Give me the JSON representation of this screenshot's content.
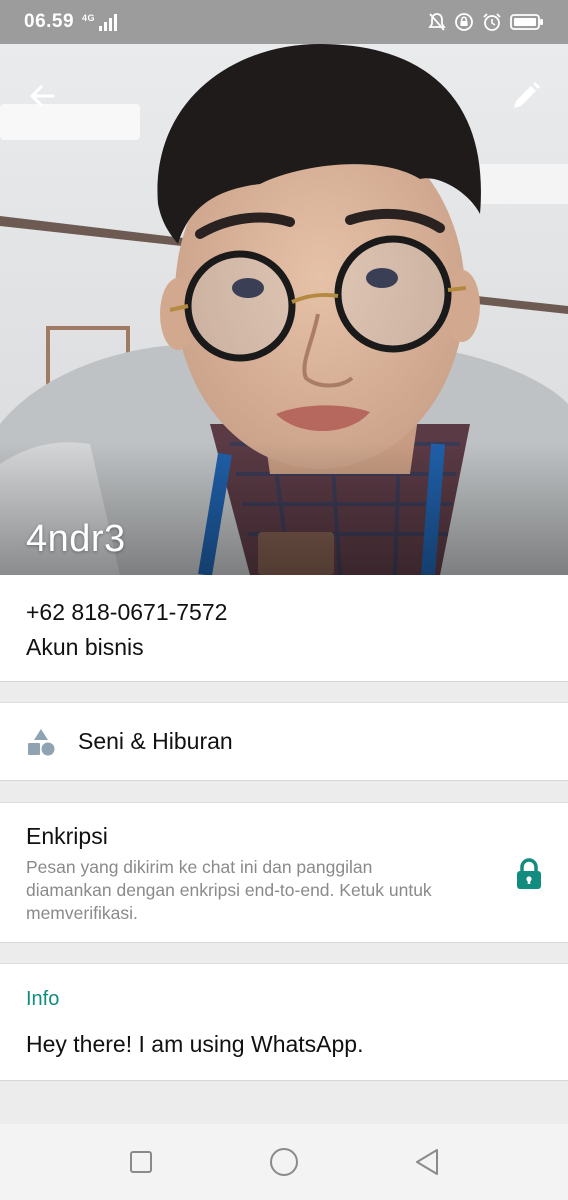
{
  "status_bar": {
    "time": "06.59",
    "network": "4G",
    "icons": [
      "mute-icon",
      "data-saver-icon",
      "alarm-icon",
      "battery-icon"
    ]
  },
  "header": {
    "profile_name": "4ndr3",
    "back_icon": "arrow-back-icon",
    "edit_icon": "pencil-icon"
  },
  "contact": {
    "phone": "+62 818-0671-7572",
    "account_type": "Akun bisnis"
  },
  "category": {
    "label": "Seni & Hiburan",
    "icon": "category-shapes-icon"
  },
  "encryption": {
    "title": "Enkripsi",
    "description": "Pesan yang dikirim ke chat ini dan panggilan diamankan dengan enkripsi end-to-end. Ketuk untuk memverifikasi.",
    "icon": "lock-icon"
  },
  "info": {
    "title": "Info",
    "about": "Hey there! I am using WhatsApp."
  },
  "nav": {
    "buttons": [
      "recents-square-icon",
      "home-circle-icon",
      "back-triangle-icon"
    ]
  },
  "colors": {
    "accent": "#128c7e",
    "status_bar": "#9c9c9c",
    "icon_grey": "#8fa3b2"
  }
}
